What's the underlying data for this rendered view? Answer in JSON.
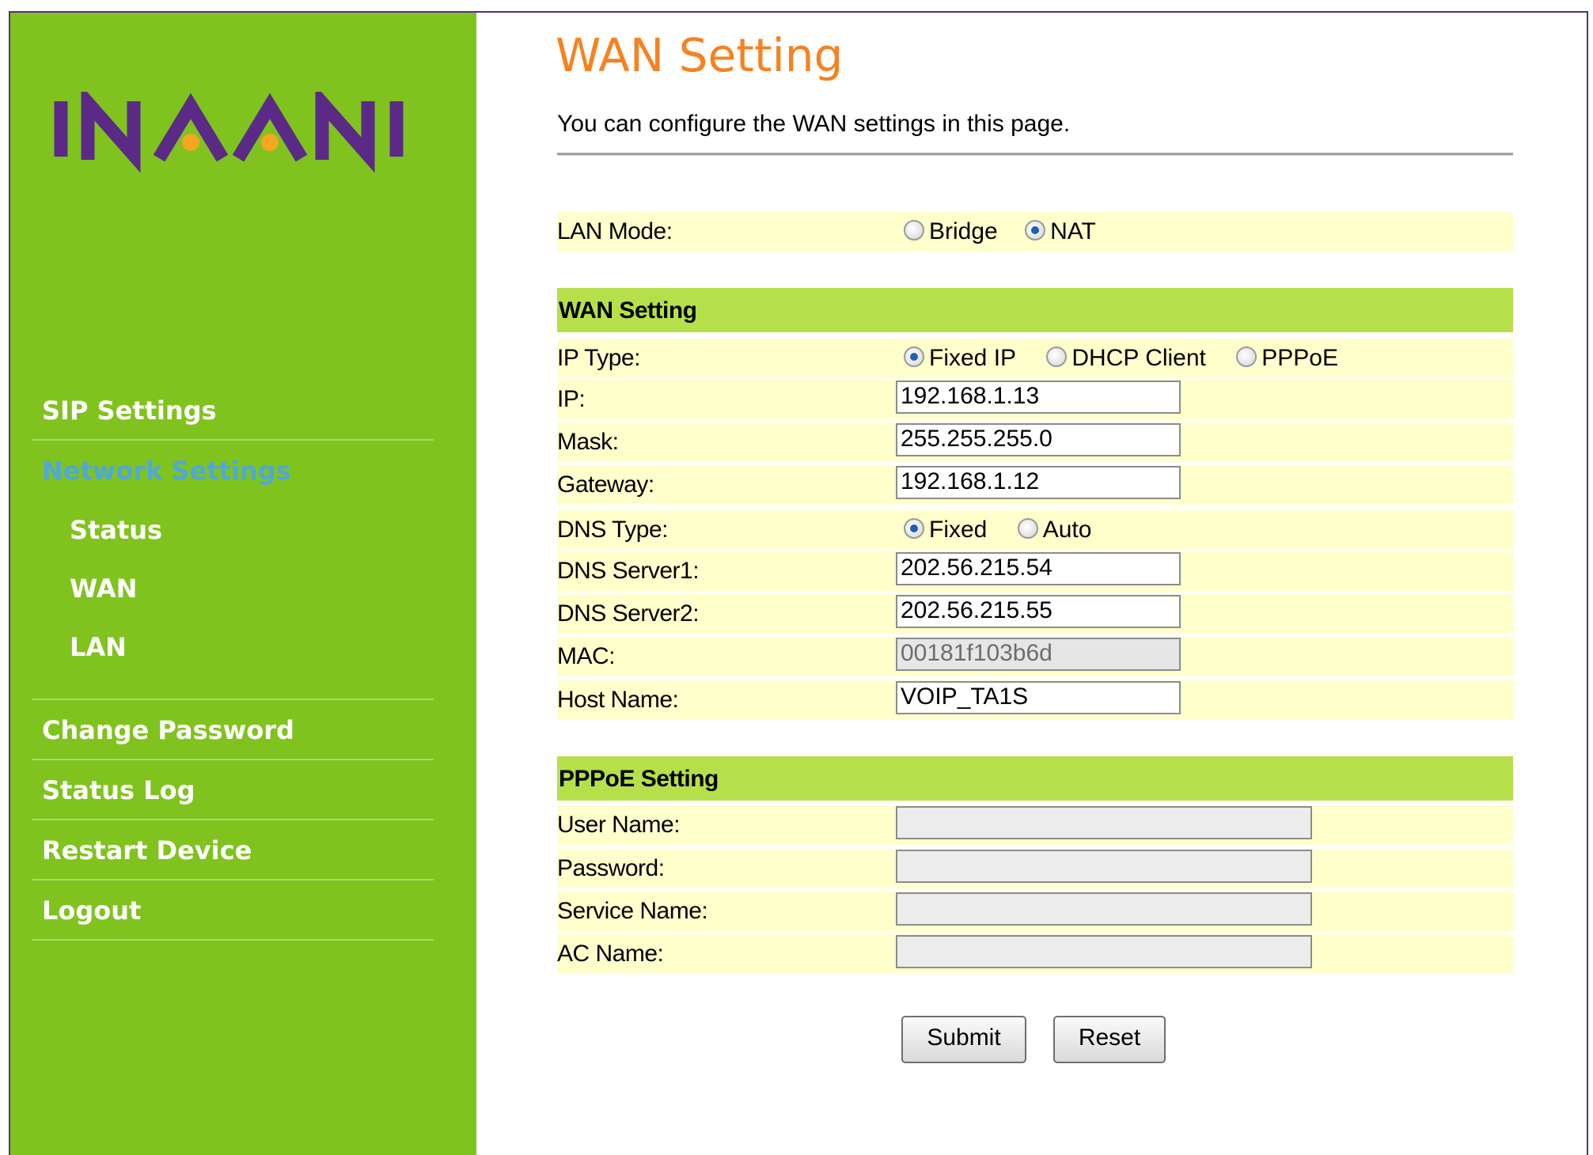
{
  "brand": {
    "logo_text": "INAANI",
    "colors": {
      "sidebar": "#80c31e",
      "logo": "#5b2a86",
      "logo_dots": "#f5a623",
      "title": "#f58220",
      "section_bar": "#b6e04a",
      "row_bg": "#ffffcc",
      "active_nav": "#4fa8d8"
    }
  },
  "sidebar": {
    "items": [
      {
        "label": "SIP Settings"
      },
      {
        "label": "Network Settings",
        "active": true
      },
      {
        "label": "Status"
      },
      {
        "label": "WAN"
      },
      {
        "label": "LAN"
      },
      {
        "label": "Change Password"
      },
      {
        "label": "Status Log"
      },
      {
        "label": "Restart Device"
      },
      {
        "label": "Logout"
      }
    ]
  },
  "page": {
    "title": "WAN Setting",
    "description": "You can configure the WAN settings in this page."
  },
  "lan_mode": {
    "label": "LAN Mode:",
    "options": [
      "Bridge",
      "NAT"
    ],
    "selected": "NAT"
  },
  "wan": {
    "section_title": "WAN Setting",
    "ip_type": {
      "label": "IP Type:",
      "options": [
        "Fixed IP",
        "DHCP Client",
        "PPPoE"
      ],
      "selected": "Fixed IP"
    },
    "ip": {
      "label": "IP:",
      "value": "192.168.1.13"
    },
    "mask": {
      "label": "Mask:",
      "value": "255.255.255.0"
    },
    "gateway": {
      "label": "Gateway:",
      "value": "192.168.1.12"
    },
    "dns_type": {
      "label": "DNS Type:",
      "options": [
        "Fixed",
        "Auto"
      ],
      "selected": "Fixed"
    },
    "dns1": {
      "label": "DNS Server1:",
      "value": "202.56.215.54"
    },
    "dns2": {
      "label": "DNS Server2:",
      "value": "202.56.215.55"
    },
    "mac": {
      "label": "MAC:",
      "value": "00181f103b6d"
    },
    "host": {
      "label": "Host Name:",
      "value": "VOIP_TA1S"
    }
  },
  "pppoe": {
    "section_title": "PPPoE Setting",
    "user": {
      "label": "User Name:",
      "value": ""
    },
    "password": {
      "label": "Password:",
      "value": ""
    },
    "service": {
      "label": "Service Name:",
      "value": ""
    },
    "ac": {
      "label": "AC Name:",
      "value": ""
    }
  },
  "buttons": {
    "submit": "Submit",
    "reset": "Reset"
  }
}
